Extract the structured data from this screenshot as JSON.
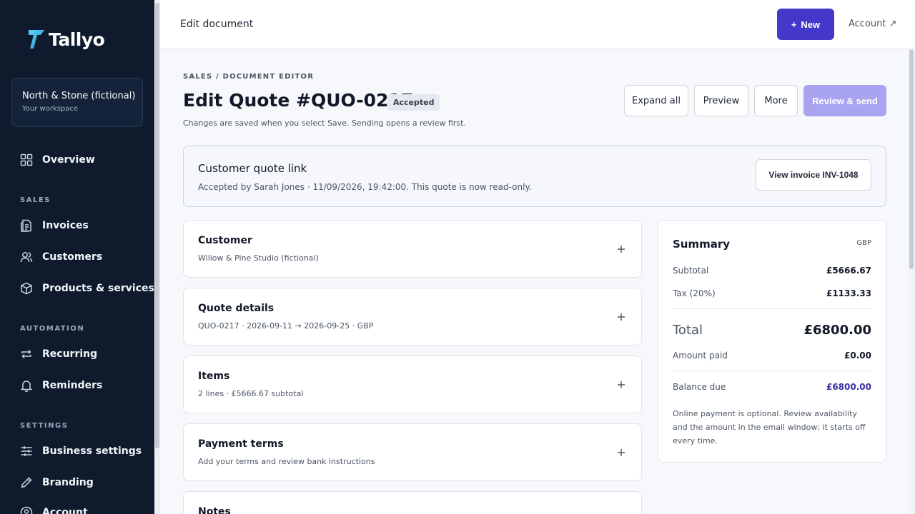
{
  "app": {
    "name": "Tallyo"
  },
  "workspace": {
    "name": "North & Stone (fictional)",
    "subtitle": "Your workspace"
  },
  "sidebar": {
    "items": [
      {
        "label": "Overview",
        "icon": "grid-icon"
      },
      {
        "section": "SALES"
      },
      {
        "label": "Invoices",
        "icon": "document-icon"
      },
      {
        "label": "Customers",
        "icon": "users-icon"
      },
      {
        "label": "Products & services",
        "icon": "box-icon"
      },
      {
        "section": "AUTOMATION"
      },
      {
        "label": "Recurring",
        "icon": "repeat-icon"
      },
      {
        "label": "Reminders",
        "icon": "bell-icon"
      },
      {
        "section": "SETTINGS"
      },
      {
        "label": "Business settings",
        "icon": "sliders-icon"
      },
      {
        "label": "Branding",
        "icon": "pen-icon"
      },
      {
        "label": "Account",
        "icon": "user-circle-icon"
      }
    ]
  },
  "topbar": {
    "title": "Edit document",
    "new_label": "New",
    "account_label": "Account ↗"
  },
  "page": {
    "breadcrumb": "SALES / DOCUMENT EDITOR",
    "title": "Edit Quote #QUO-0217",
    "status": "Accepted",
    "subtitle": "Changes are saved when you select Save. Sending opens a review first.",
    "actions": {
      "expand_all": "Expand all",
      "preview": "Preview",
      "more": "More",
      "review_send": "Review & send"
    }
  },
  "quote_link": {
    "title": "Customer quote link",
    "status_text": "Accepted by Sarah Jones · 11/09/2026, 19:42:00. This quote is now read-only.",
    "button": "View invoice INV-1048"
  },
  "sections": [
    {
      "title": "Customer",
      "subtitle": "Willow & Pine Studio (fictional)"
    },
    {
      "title": "Quote details",
      "subtitle": "QUO-0217 · 2026-09-11 → 2026-09-25 · GBP"
    },
    {
      "title": "Items",
      "subtitle": "2 lines · £5666.67 subtotal"
    },
    {
      "title": "Payment terms",
      "subtitle": "Add your terms and review bank instructions"
    },
    {
      "title": "Notes",
      "subtitle": ""
    }
  ],
  "summary": {
    "title": "Summary",
    "currency": "GBP",
    "subtotal_label": "Subtotal",
    "subtotal": "£5666.67",
    "tax_label": "Tax (20%)",
    "tax": "£1133.33",
    "total_label": "Total",
    "total": "£6800.00",
    "paid_label": "Amount paid",
    "paid": "£0.00",
    "balance_label": "Balance due",
    "balance": "£6800.00",
    "note": "Online payment is optional. Review availability and the amount in the email window; it starts off every time."
  },
  "colors": {
    "sidebar_bg": "#0f1b2d",
    "accent": "#4338ca",
    "accent_disabled": "#a8a4f0",
    "logo_mark": "#3fb8e8"
  }
}
